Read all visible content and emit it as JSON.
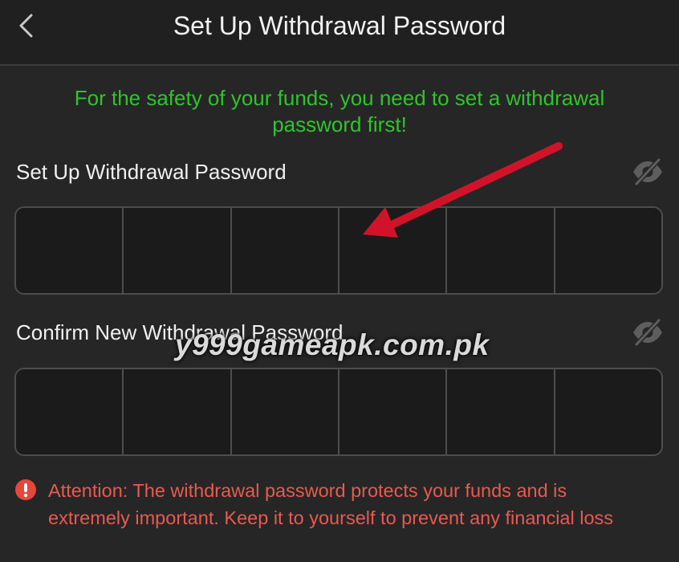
{
  "header": {
    "title": "Set Up Withdrawal Password",
    "back_icon": "chevron-left-icon"
  },
  "notice": "For the safety of your funds, you need to set a withdrawal password first!",
  "colors": {
    "background": "#262626",
    "notice": "#2ec52b",
    "warning": "#e85a4f",
    "arrow": "#d1132a"
  },
  "fields": [
    {
      "label": "Set Up Withdrawal Password",
      "visibility_icon": "eye-slash-icon",
      "digits": [
        "",
        "",
        "",
        "",
        "",
        ""
      ]
    },
    {
      "label": "Confirm New Withdrawal Password",
      "visibility_icon": "eye-slash-icon",
      "digits": [
        "",
        "",
        "",
        "",
        "",
        ""
      ]
    }
  ],
  "attention": {
    "icon": "exclamation-circle-icon",
    "text": "Attention: The withdrawal password protects your funds and is extremely important. Keep it to yourself to prevent any financial loss"
  },
  "watermark": "y999gameapk.com.pk"
}
